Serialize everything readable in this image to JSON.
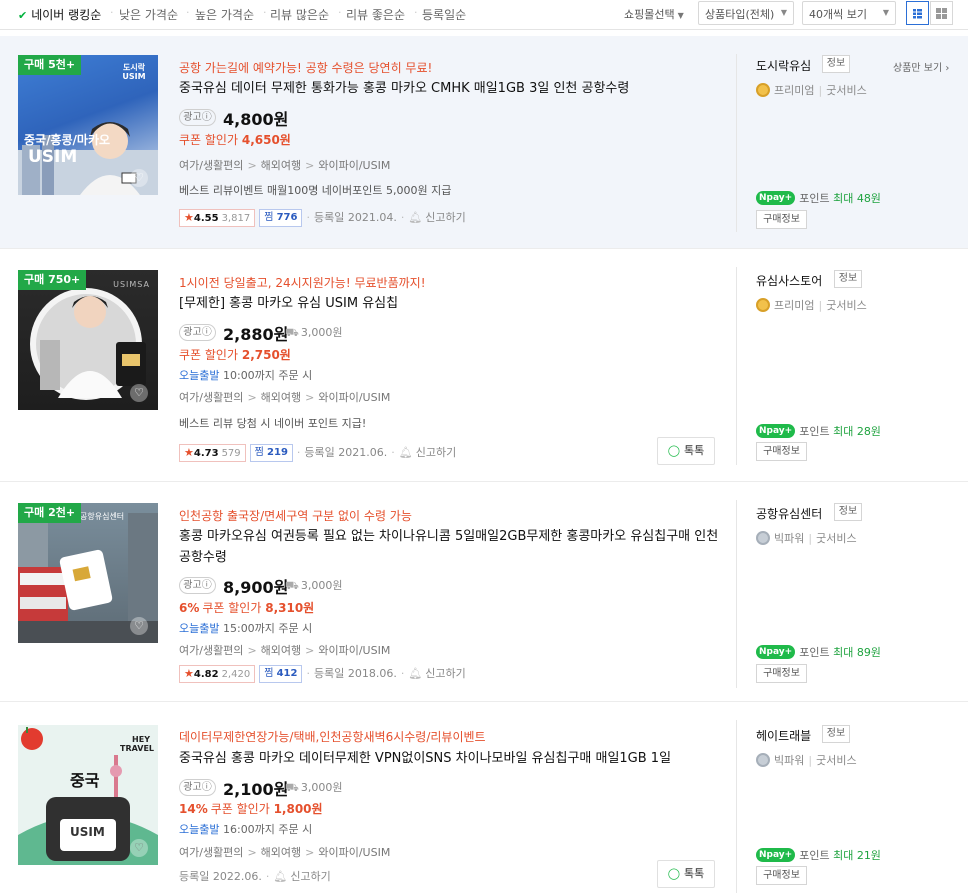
{
  "sort_options": [
    "네이버 랭킹순",
    "낮은 가격순",
    "높은 가격순",
    "리뷰 많은순",
    "리뷰 좋은순",
    "등록일순"
  ],
  "toolbar": {
    "mall_select": "쇼핑몰선택",
    "product_type": "상품타입(전체)",
    "per_page": "40개씩 보기"
  },
  "products": [
    {
      "badge": "구매 5천+",
      "promo": "공항 가는길에 예약가능! 공항 수령은 당연히 무료!",
      "title": "중국유심 데이터 무제한 통화가능 홍콩 마카오 CMHK 매일1GB 3일 인천 공항수령",
      "ad": "광고ⓘ",
      "price": "4,800원",
      "shipping": "",
      "coupon_pct": "",
      "coupon_label": "쿠폰 할인가",
      "coupon_price": "4,650원",
      "today_label": "",
      "today_time": "",
      "category": [
        "여가/생활편의",
        "해외여행",
        "와이파이/USIM"
      ],
      "desc": "베스트 리뷰이벤트 매월100명 네이버포인트 5,000원 지급",
      "rating": "4.55",
      "review_count": "3,817",
      "zzim": "776",
      "reg_date": "등록일 2021.04.",
      "report": "신고하기",
      "talk": "",
      "mall": "도시락유심",
      "grade": "프리미엄",
      "service": "굿서비스",
      "store_only": "상품만 보기",
      "point": "최대 48원",
      "buy_info": "구매정보",
      "thumb_text": "중국/홍콩/마카오",
      "thumb_sub": "USIM",
      "thumb_brand": "도시락 USIM"
    },
    {
      "badge": "구매 750+",
      "promo": "1시이전 당일출고, 24시지원가능! 무료반품까지!",
      "title": "[무제한] 홍콩 마카오 유심 USIM 유심칩",
      "ad": "광고ⓘ",
      "price": "2,880원",
      "shipping": "3,000원",
      "coupon_pct": "",
      "coupon_label": "쿠폰 할인가",
      "coupon_price": "2,750원",
      "today_label": "오늘출발",
      "today_time": "10:00까지 주문 시",
      "category": [
        "여가/생활편의",
        "해외여행",
        "와이파이/USIM"
      ],
      "desc": "베스트 리뷰 당첨 시 네이버 포인트 지급!",
      "rating": "4.73",
      "review_count": "579",
      "zzim": "219",
      "reg_date": "등록일 2021.06.",
      "report": "신고하기",
      "talk": "톡톡",
      "mall": "유심사스토어",
      "grade": "프리미엄",
      "service": "굿서비스",
      "store_only": "",
      "point": "최대 28원",
      "buy_info": "구매정보",
      "thumb_text": "",
      "thumb_sub": "",
      "thumb_brand": "USIMSA"
    },
    {
      "badge": "구매 2천+",
      "promo": "인천공항 출국장/면세구역 구분 없이 수령 가능",
      "title": "홍콩 마카오유심 여권등록 필요 없는 차이나유니콤 5일매일2GB무제한 홍콩마카오 유심칩구매 인천공항수령",
      "ad": "광고ⓘ",
      "price": "8,900원",
      "shipping": "3,000원",
      "coupon_pct": "6%",
      "coupon_label": "쿠폰 할인가",
      "coupon_price": "8,310원",
      "today_label": "오늘출발",
      "today_time": "15:00까지 주문 시",
      "category": [
        "여가/생활편의",
        "해외여행",
        "와이파이/USIM"
      ],
      "desc": "",
      "rating": "4.82",
      "review_count": "2,420",
      "zzim": "412",
      "reg_date": "등록일 2018.06.",
      "report": "신고하기",
      "talk": "",
      "mall": "공항유심센터",
      "grade": "빅파워",
      "service": "굿서비스",
      "store_only": "",
      "point": "최대 89원",
      "buy_info": "구매정보",
      "thumb_text": "",
      "thumb_sub": "",
      "thumb_brand": "공항유심센터"
    },
    {
      "badge": "",
      "promo": "데이터무제한연장가능/택배,인천공항새벽6시수령/리뷰이벤트",
      "title": "중국유심 홍콩 마카오 데이터무제한 VPN없이SNS 차이나모바일 유심칩구매 매일1GB 1일",
      "ad": "광고ⓘ",
      "price": "2,100원",
      "shipping": "3,000원",
      "coupon_pct": "14%",
      "coupon_label": "쿠폰 할인가",
      "coupon_price": "1,800원",
      "today_label": "오늘출발",
      "today_time": "16:00까지 주문 시",
      "category": [
        "여가/생활편의",
        "해외여행",
        "와이파이/USIM"
      ],
      "desc": "",
      "rating": "",
      "review_count": "",
      "zzim": "",
      "reg_date": "등록일 2022.06.",
      "report": "신고하기",
      "talk": "톡톡",
      "mall": "헤이트래블",
      "grade": "빅파워",
      "service": "굿서비스",
      "store_only": "",
      "point": "최대 21원",
      "buy_info": "구매정보",
      "thumb_text": "중국",
      "thumb_sub": "USIM",
      "thumb_brand": "HEY TRAVEL"
    }
  ],
  "labels": {
    "info": "정보",
    "point_prefix": "포인트",
    "npay": "pay",
    "npay_plus": "+"
  }
}
